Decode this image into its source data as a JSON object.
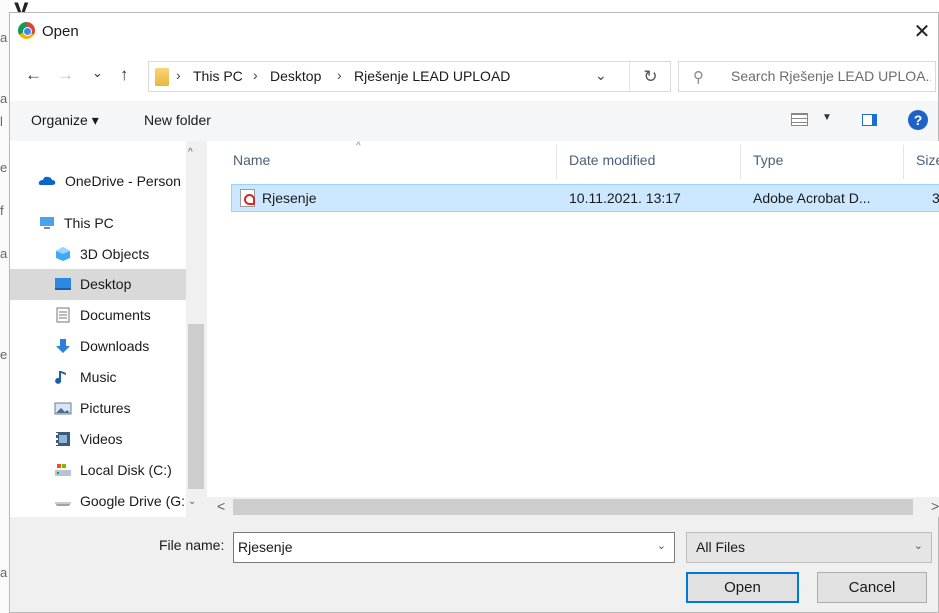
{
  "background": {
    "heading": "y",
    "side_letters": [
      "a",
      "a",
      "l",
      "e",
      "f",
      "a",
      "e",
      "a"
    ]
  },
  "dialog": {
    "title": "Open",
    "close_glyph": "✕"
  },
  "navigation": {
    "back_glyph": "←",
    "forward_glyph": "→",
    "recent_glyph": "⌄",
    "up_glyph": "↑",
    "breadcrumb": [
      "This PC",
      "Desktop",
      "Rješenje LEAD UPLOAD"
    ],
    "separator": "›",
    "dropdown_glyph": "⌄",
    "refresh_glyph": "↻"
  },
  "search": {
    "placeholder": "Search Rješenje LEAD UPLOA..."
  },
  "commandbar": {
    "organize": "Organize ▾",
    "new_folder": "New folder",
    "view_dropdown": "▼",
    "help": "?"
  },
  "sidebar": {
    "items": [
      {
        "label": "OneDrive - Person",
        "icon": "onedrive-icon"
      },
      {
        "label": "This PC",
        "icon": "this-pc-icon"
      },
      {
        "label": "3D Objects",
        "icon": "3d-objects-icon"
      },
      {
        "label": "Desktop",
        "icon": "desktop-icon",
        "selected": true
      },
      {
        "label": "Documents",
        "icon": "documents-icon"
      },
      {
        "label": "Downloads",
        "icon": "downloads-icon"
      },
      {
        "label": "Music",
        "icon": "music-icon"
      },
      {
        "label": "Pictures",
        "icon": "pictures-icon"
      },
      {
        "label": "Videos",
        "icon": "videos-icon"
      },
      {
        "label": "Local Disk (C:)",
        "icon": "local-disk-icon"
      },
      {
        "label": "Google Drive (G:",
        "icon": "google-drive-icon"
      }
    ],
    "scroll_up": "^",
    "scroll_down": "⌄"
  },
  "filelist": {
    "columns": [
      "Name",
      "Date modified",
      "Type",
      "Size"
    ],
    "sort_caret": "^",
    "rows": [
      {
        "name": "Rjesenje",
        "date": "10.11.2021. 13:17",
        "type": "Adobe Acrobat D...",
        "size": "3",
        "selected": true
      }
    ],
    "scroll_left": "<",
    "scroll_right": ">"
  },
  "footer": {
    "filename_label": "File name:",
    "filename_value": "Rjesenje",
    "filename_dropdown": "⌄",
    "filter_value": "All Files",
    "filter_dropdown": "⌄",
    "open_button": "Open",
    "cancel_button": "Cancel"
  },
  "colors": {
    "selection_bg": "#cce8ff",
    "selection_border": "#99d1ff",
    "accent": "#0078d7",
    "nav_selected": "#d9d9d9"
  }
}
